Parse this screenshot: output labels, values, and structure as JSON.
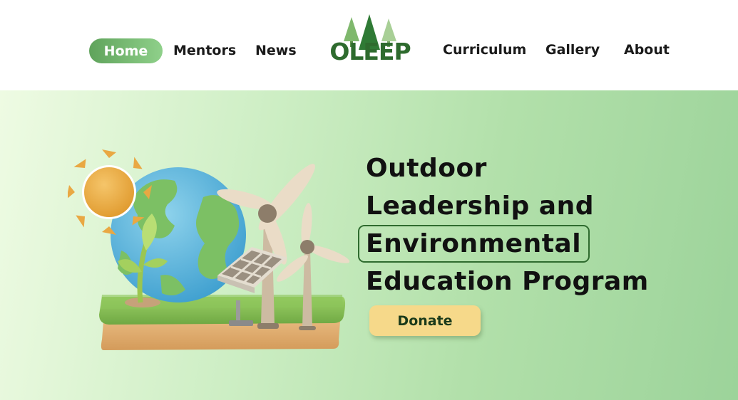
{
  "nav": {
    "home_label": "Home",
    "mentors_label": "Mentors",
    "news_label": "News",
    "curriculum_label": "Curriculum",
    "gallery_label": "Gallery",
    "about_label": "About",
    "logo_text": "OLEEP"
  },
  "hero": {
    "headline_line1": "Outdoor",
    "headline_line2": "Leadership and",
    "headline_highlight": "Environmental",
    "headline_line4": "Education Program",
    "donate_label": "Donate",
    "illustration_icons": [
      "sun-icon",
      "globe-icon",
      "wind-turbine-icon",
      "solar-panel-icon",
      "sprout-icon"
    ]
  },
  "colors": {
    "brand_green": "#2e6b2e",
    "home_pill": "#6fb86a",
    "donate_bg": "#f6d98a",
    "hero_bg": "#b8e3b0"
  }
}
